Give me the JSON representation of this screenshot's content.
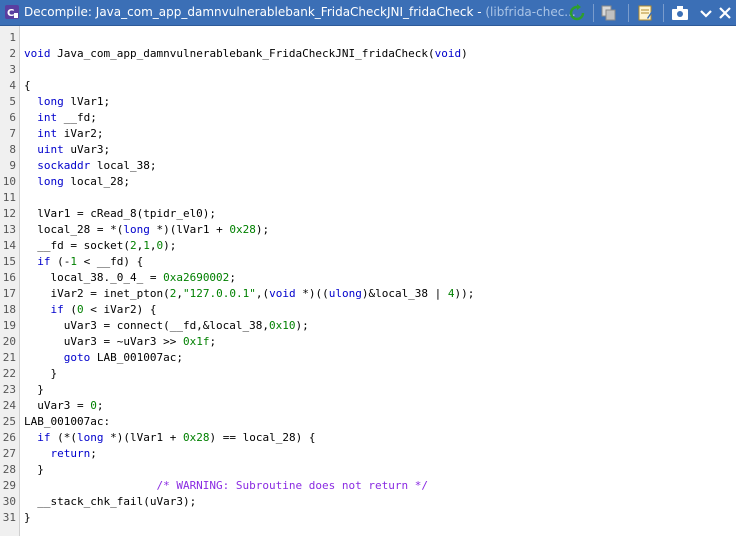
{
  "window": {
    "title_main": "Decompile: Java_com_app_damnvulnerablebank_FridaCheckJNI_fridaCheck - ",
    "title_sub": "(libfrida-chec...",
    "icons": [
      "ghidra-icon",
      "refresh-icon",
      "copy-icon",
      "edit-icon",
      "snapshot-icon",
      "chevron-down-icon",
      "close-icon"
    ]
  },
  "code": {
    "lines": [
      {
        "n": "1",
        "t": ""
      },
      {
        "n": "2",
        "t": "void Java_com_app_damnvulnerablebank_FridaCheckJNI_fridaCheck(void)"
      },
      {
        "n": "3",
        "t": ""
      },
      {
        "n": "4",
        "t": "{"
      },
      {
        "n": "5",
        "t": "  long lVar1;"
      },
      {
        "n": "6",
        "t": "  int __fd;"
      },
      {
        "n": "7",
        "t": "  int iVar2;"
      },
      {
        "n": "8",
        "t": "  uint uVar3;"
      },
      {
        "n": "9",
        "t": "  sockaddr local_38;"
      },
      {
        "n": "10",
        "t": "  long local_28;"
      },
      {
        "n": "11",
        "t": ""
      },
      {
        "n": "12",
        "t": "  lVar1 = cRead_8(tpidr_el0);"
      },
      {
        "n": "13",
        "t": "  local_28 = *(long *)(lVar1 + 0x28);"
      },
      {
        "n": "14",
        "t": "  __fd = socket(2,1,0);"
      },
      {
        "n": "15",
        "t": "  if (-1 < __fd) {"
      },
      {
        "n": "16",
        "t": "    local_38._0_4_ = 0xa2690002;"
      },
      {
        "n": "17",
        "t": "    iVar2 = inet_pton(2,\"127.0.0.1\",(void *)((ulong)&local_38 | 4));"
      },
      {
        "n": "18",
        "t": "    if (0 < iVar2) {"
      },
      {
        "n": "19",
        "t": "      uVar3 = connect(__fd,&local_38,0x10);"
      },
      {
        "n": "20",
        "t": "      uVar3 = ~uVar3 >> 0x1f;"
      },
      {
        "n": "21",
        "t": "      goto LAB_001007ac;"
      },
      {
        "n": "22",
        "t": "    }"
      },
      {
        "n": "23",
        "t": "  }"
      },
      {
        "n": "24",
        "t": "  uVar3 = 0;"
      },
      {
        "n": "25",
        "t": "LAB_001007ac:"
      },
      {
        "n": "26",
        "t": "  if (*(long *)(lVar1 + 0x28) == local_28) {"
      },
      {
        "n": "27",
        "t": "    return;"
      },
      {
        "n": "28",
        "t": "  }"
      },
      {
        "n": "29",
        "t": "                    /* WARNING: Subroutine does not return */"
      },
      {
        "n": "30",
        "t": "  __stack_chk_fail(uVar3);"
      },
      {
        "n": "31",
        "t": "}"
      }
    ]
  }
}
